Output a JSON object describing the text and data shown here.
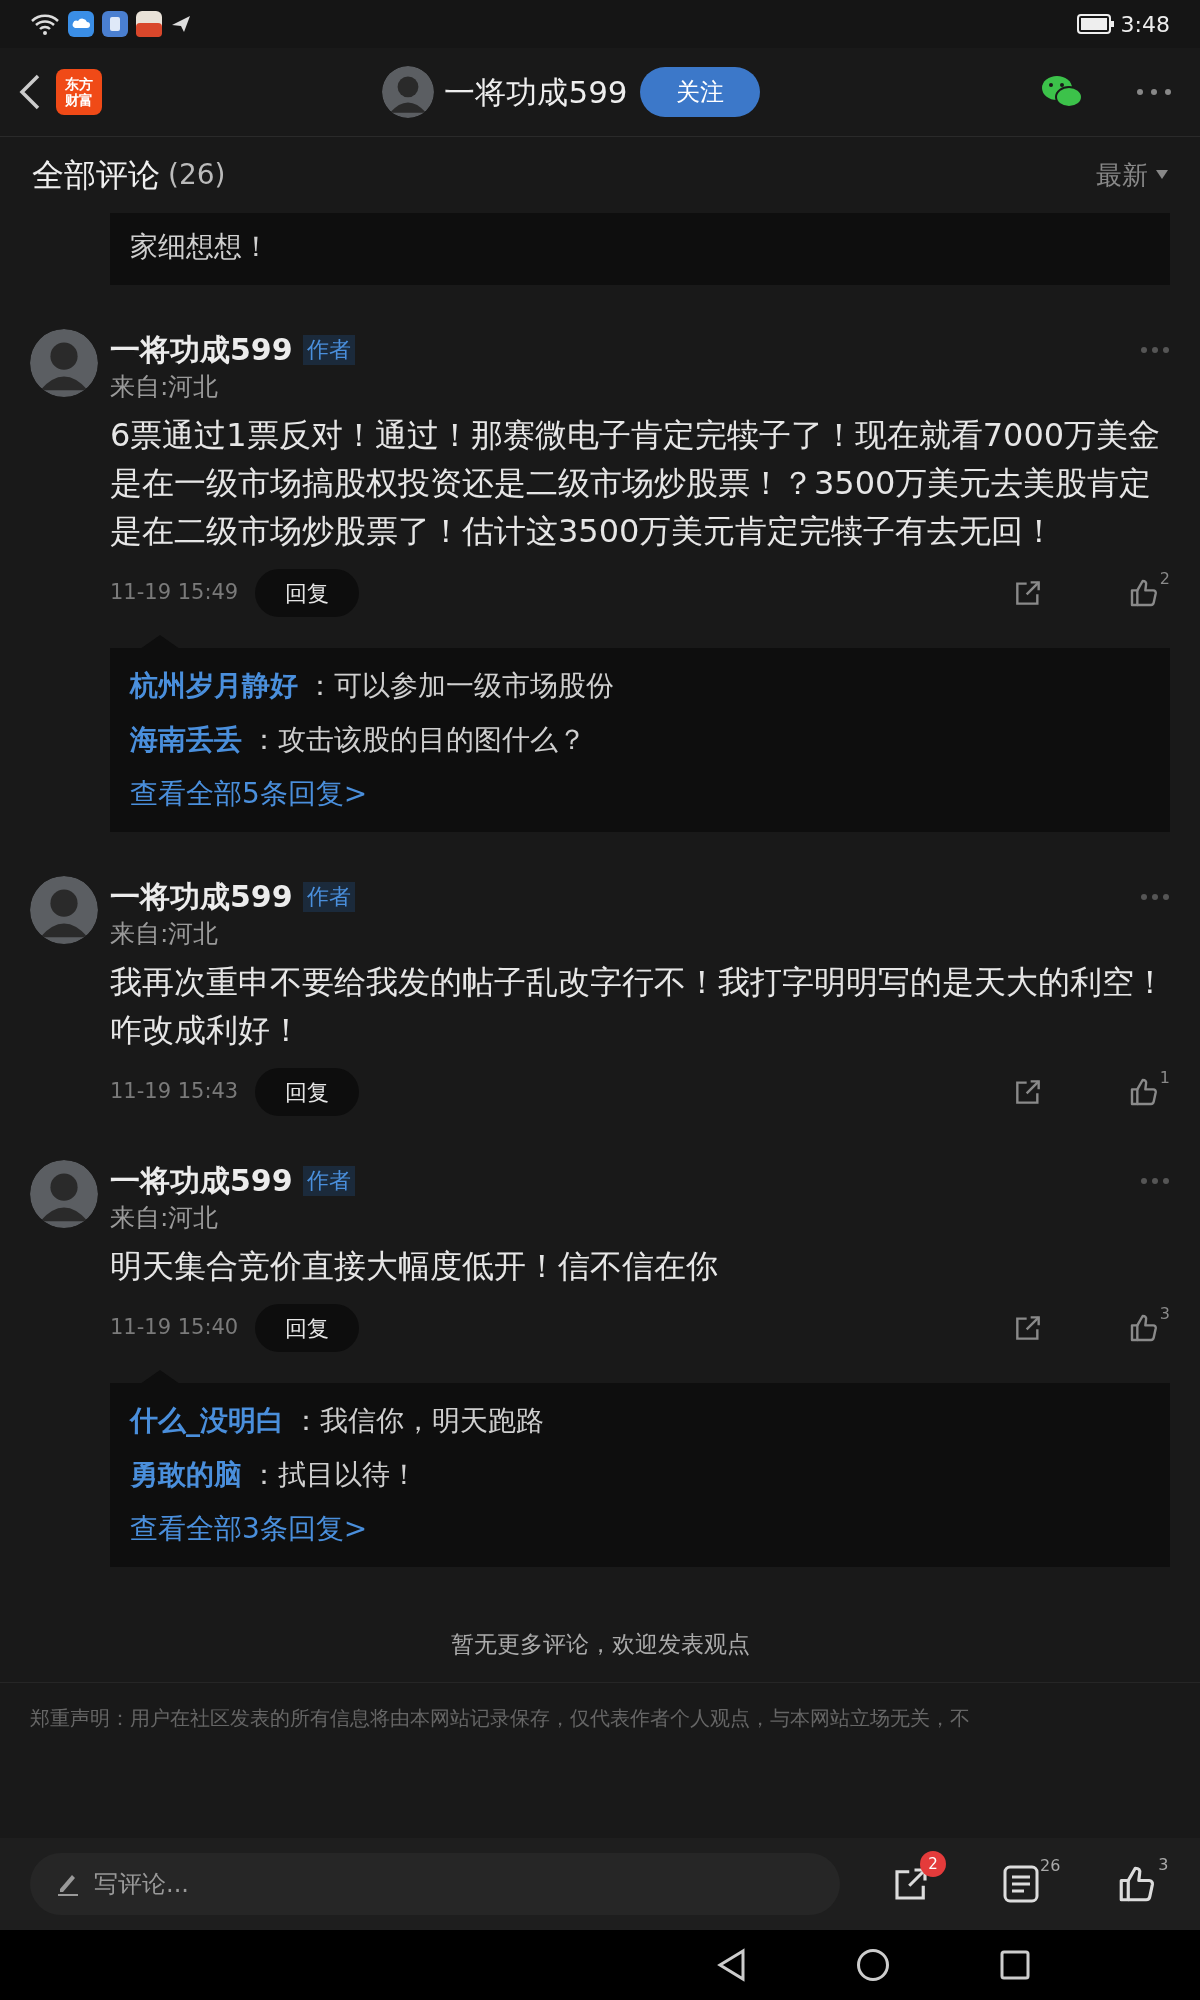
{
  "status_bar": {
    "time": "3:48"
  },
  "header": {
    "app_logo": [
      "东方",
      "财富"
    ],
    "user": "一将功成599",
    "follow_button": "关注"
  },
  "section": {
    "title": "全部评论",
    "count": "(26)",
    "sort": "最新"
  },
  "partial_reply": {
    "text": "家细想想！"
  },
  "comments": [
    {
      "author": "一将功成599",
      "badge": "作者",
      "location": "来自:河北",
      "text": "6票通过1票反对！通过！那赛微电子肯定完犊子了！现在就看7000万美金是在一级市场搞股权投资还是二级市场炒股票！？3500万美元去美股肯定是在二级市场炒股票了！估计这3500万美元肯定完犊子有去无回！",
      "time": "11-19 15:49",
      "reply_button": "回复",
      "likes": "2",
      "replies": [
        {
          "name": "杭州岁月静好",
          "text": "：可以参加一级市场股份"
        },
        {
          "name": "海南丢丢",
          "text": "：攻击该股的目的图什么？"
        }
      ],
      "view_all": "查看全部5条回复>"
    },
    {
      "author": "一将功成599",
      "badge": "作者",
      "location": "来自:河北",
      "text": "我再次重申不要给我发的帖子乱改字行不！我打字明明写的是天大的利空！咋改成利好！",
      "time": "11-19 15:43",
      "reply_button": "回复",
      "likes": "1"
    },
    {
      "author": "一将功成599",
      "badge": "作者",
      "location": "来自:河北",
      "text": "明天集合竞价直接大幅度低开！信不信在你",
      "time": "11-19 15:40",
      "reply_button": "回复",
      "likes": "3",
      "replies": [
        {
          "name": "什么_没明白",
          "text": "：我信你，明天跑路"
        },
        {
          "name": "勇敢的脑",
          "text": "：拭目以待！"
        }
      ],
      "view_all": "查看全部3条回复>"
    }
  ],
  "end_note": "暂无更多评论，欢迎发表观点",
  "disclaimer": "郑重声明：用户在社区发表的所有信息将由本网站记录保存，仅代表作者个人观点，与本网站立场无关，不",
  "bottom_bar": {
    "placeholder": "写评论...",
    "share_badge": "2",
    "comments_count": "26",
    "likes_count": "3"
  }
}
